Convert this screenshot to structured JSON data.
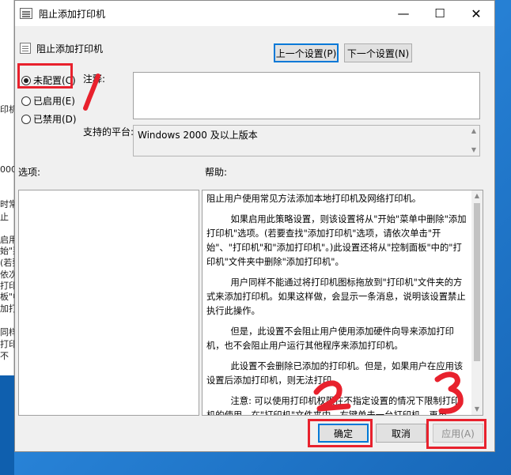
{
  "window": {
    "title": "阻止添加打印机",
    "minimize_glyph": "—",
    "maximize_glyph": "☐",
    "close_glyph": "✕"
  },
  "background_window": {
    "fragments": [
      "印机",
      "000",
      "时常见",
      "止",
      "启用",
      "始\"菜",
      "(若要",
      "依次",
      "打印",
      "板\"中",
      "加打印",
      "同样",
      "打印",
      "不"
    ]
  },
  "policy_name": "阻止添加打印机",
  "nav": {
    "prev_label": "上一个设置(P)",
    "next_label": "下一个设置(N)"
  },
  "state_options": [
    {
      "label": "未配置(C)",
      "selected": true
    },
    {
      "label": "已启用(E)",
      "selected": false
    },
    {
      "label": "已禁用(D)",
      "selected": false
    }
  ],
  "comment": {
    "label": "注释:",
    "value": ""
  },
  "platform": {
    "label": "支持的平台:",
    "value": "Windows 2000 及以上版本"
  },
  "options_label": "选项:",
  "help_label": "帮助:",
  "help_paragraphs": [
    "阻止用户使用常见方法添加本地打印机及网络打印机。",
    "如果启用此策略设置，则该设置将从\"开始\"菜单中删除\"添加打印机\"选项。(若要查找\"添加打印机\"选项，请依次单击\"开始\"、\"打印机\"和\"添加打印机\"。)此设置还将从\"控制面板\"中的\"打印机\"文件夹中删除\"添加打印机\"。",
    "用户同样不能通过将打印机图标拖放到\"打印机\"文件夹的方式来添加打印机。如果这样做，会显示一条消息，说明该设置禁止执行此操作。",
    "但是，此设置不会阻止用户使用添加硬件向导来添加打印机，也不会阻止用户运行其他程序来添加打印机。",
    "此设置不会删除已添加的打印机。但是，如果用户在应用该设置后添加打印机，则无法打印。",
    "注意: 可以使用打印机权限在不指定设置的情况下限制打印机的使用。在\"打印机\"文件夹中，右键单击一台打印机，再单击\"属性\"，然后单击\"安全\"选项卡。"
  ],
  "footer": {
    "ok_label": "确定",
    "cancel_label": "取消",
    "apply_label": "应用(A)"
  },
  "annotations": {
    "color": "#e8212d",
    "numbers": [
      "1",
      "2",
      "3"
    ]
  }
}
